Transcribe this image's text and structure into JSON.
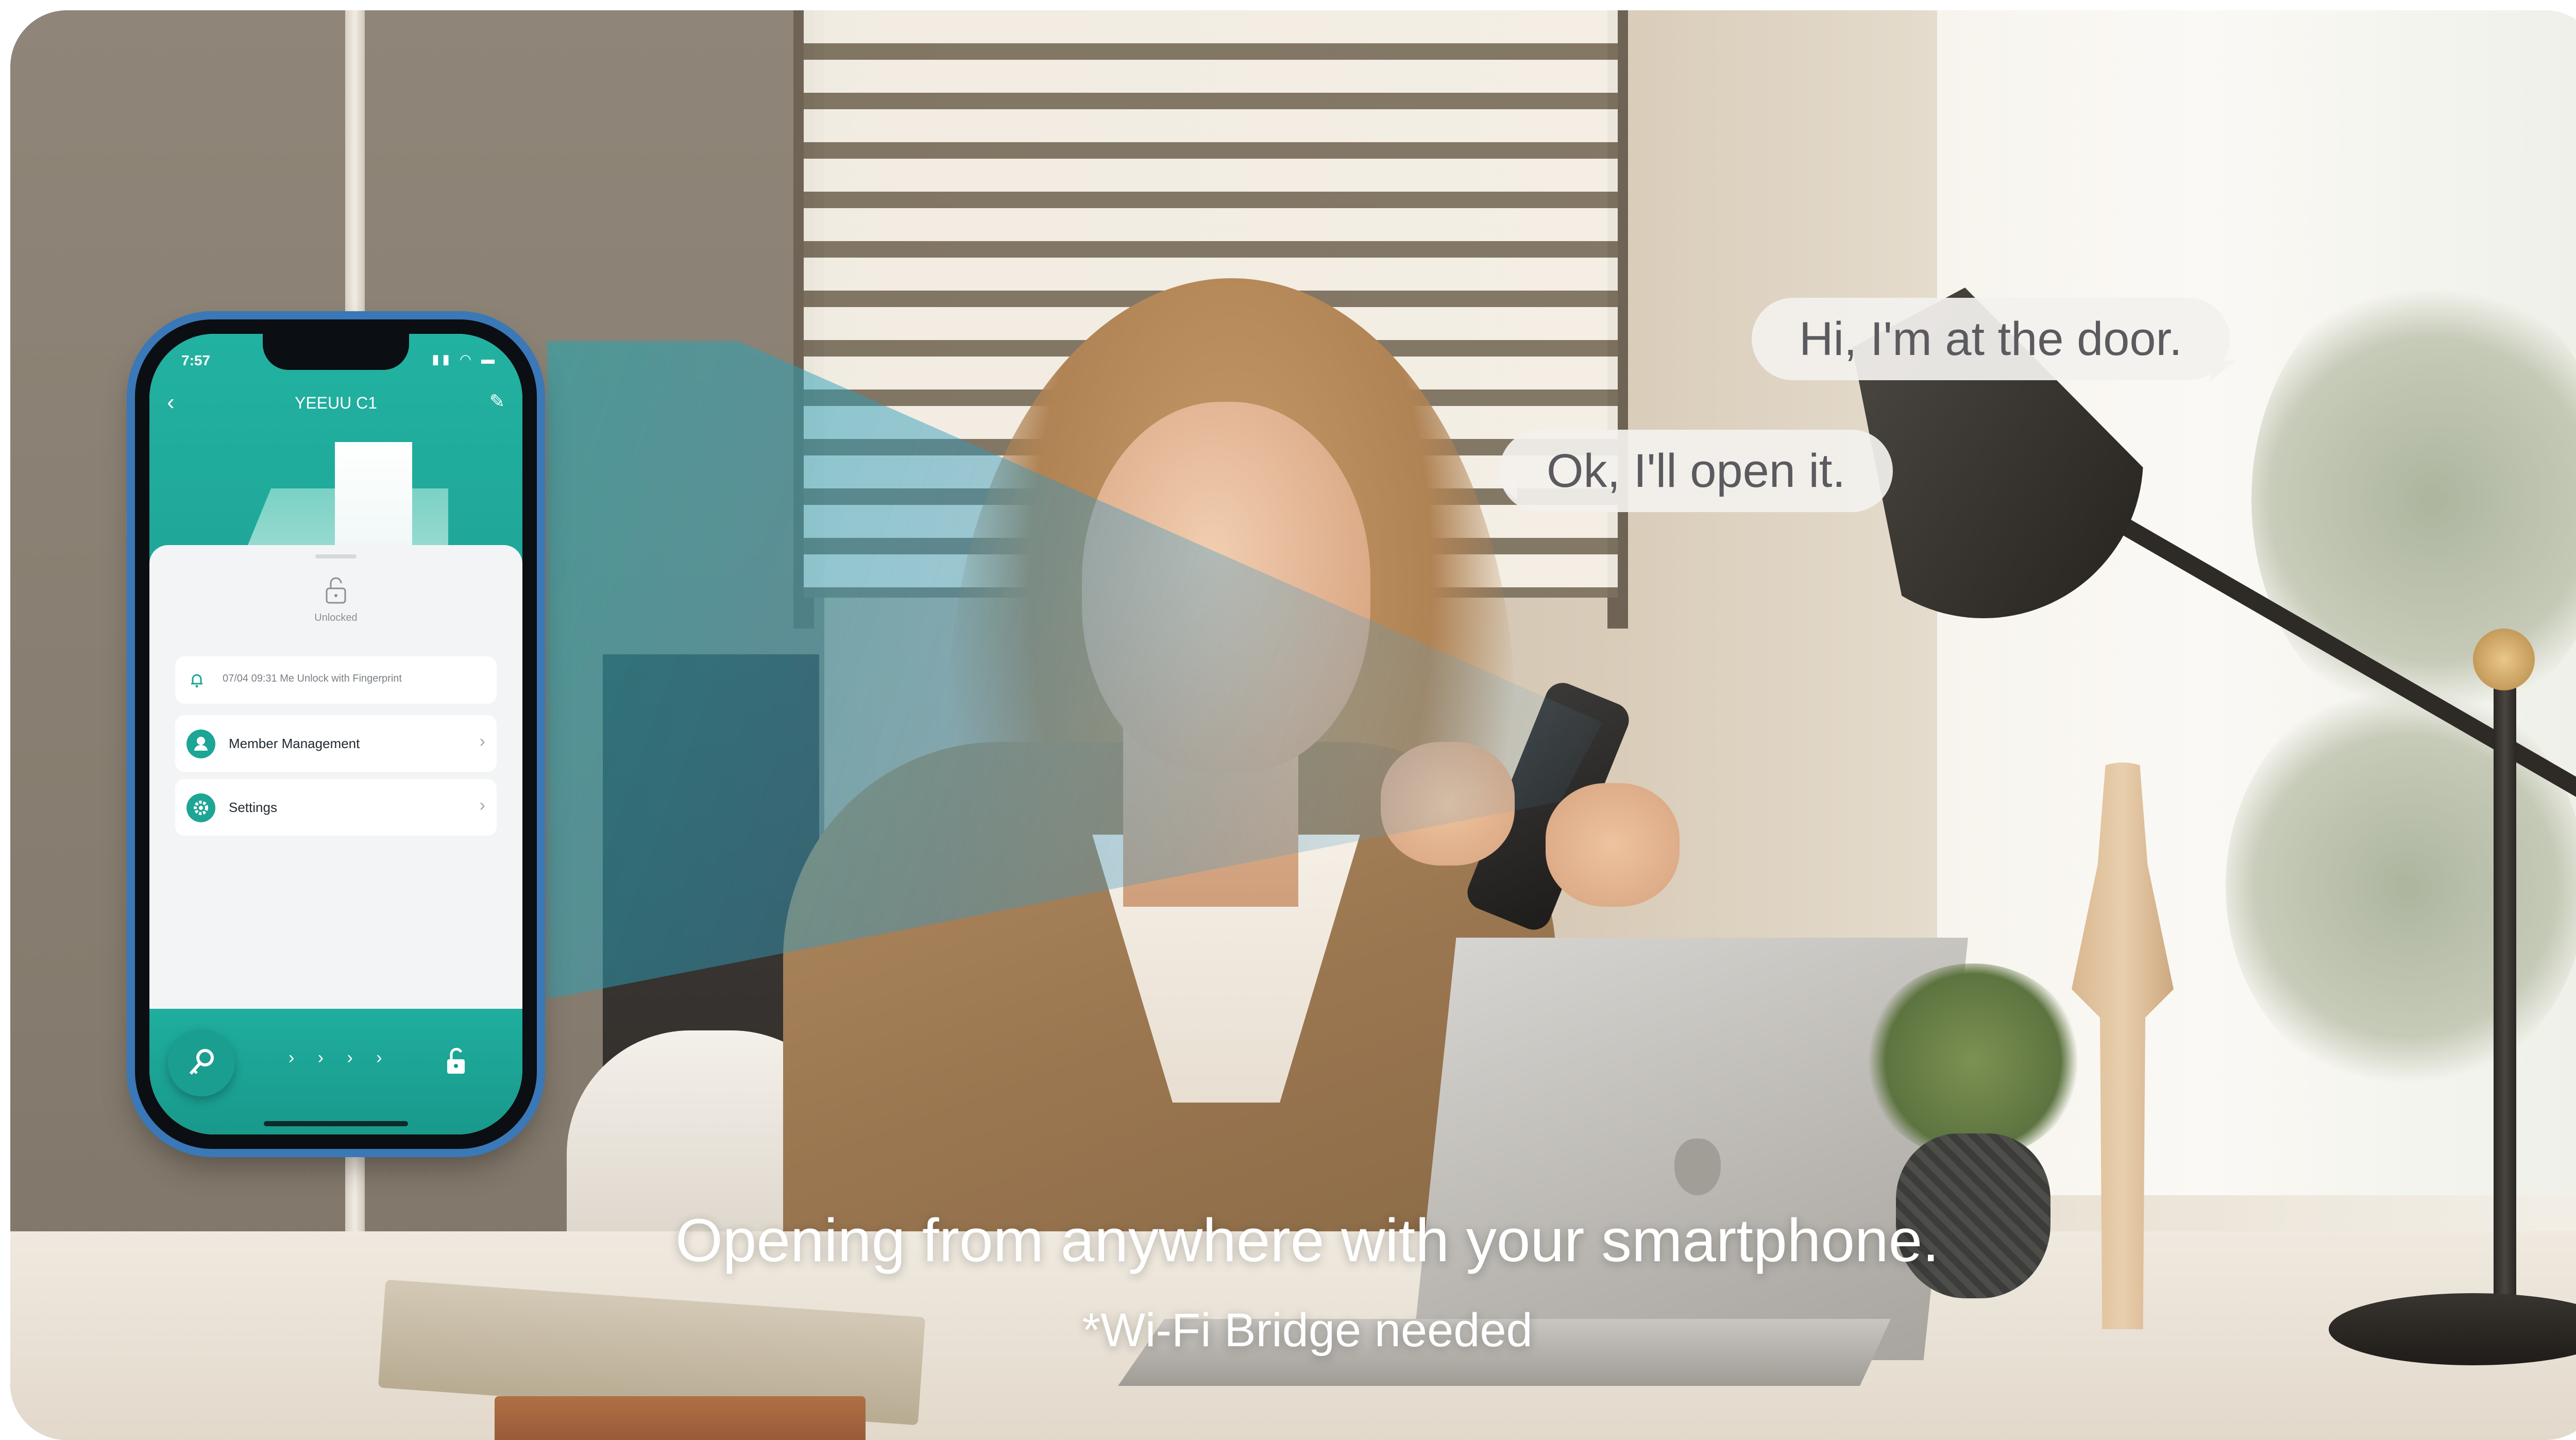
{
  "phone": {
    "status_time": "7:57",
    "status_icons": "▮▮ ◠ ▬",
    "title": "YEEUU C1",
    "lock_state": "Unlocked",
    "log_entry": "07/04 09:31 Me   Unlock with Fingerprint",
    "menu": [
      {
        "label": "Member Management",
        "icon": "person-icon"
      },
      {
        "label": "Settings",
        "icon": "gear-icon"
      }
    ],
    "slide_arrows": "› › › ›"
  },
  "bubbles": {
    "first": "Hi, I'm at the door.",
    "second": "Ok, I'll open it."
  },
  "caption": {
    "main": "Opening from anywhere with your smartphone.",
    "note": "*Wi-Fi Bridge needed"
  },
  "colors": {
    "app_teal": "#1ea496",
    "beam": "#1caab4"
  }
}
